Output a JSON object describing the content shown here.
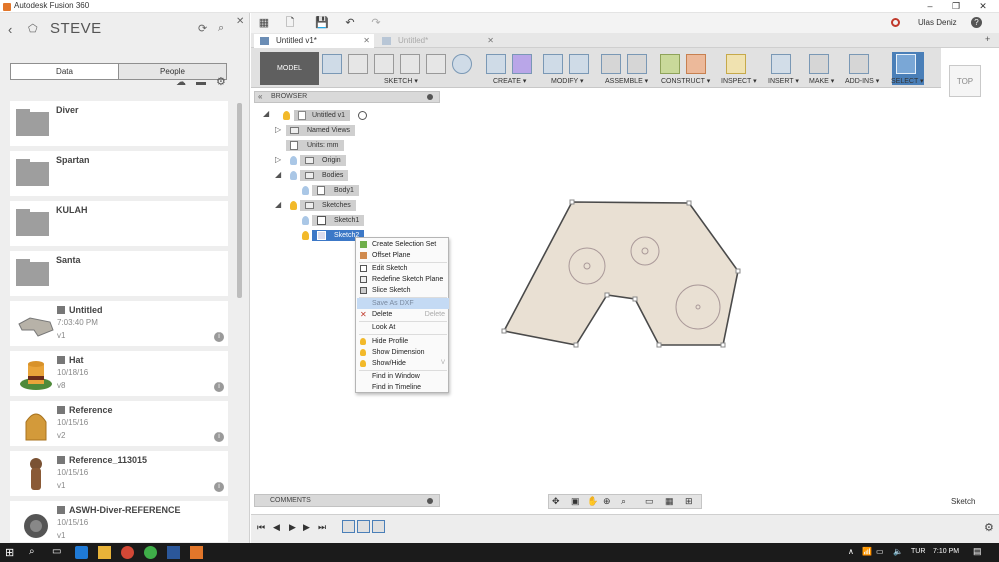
{
  "window": {
    "title": "Autodesk Fusion 360"
  },
  "data_panel": {
    "project": "STEVE",
    "tabs": [
      {
        "label": "Data"
      },
      {
        "label": "People"
      }
    ],
    "folders": [
      {
        "name": "Diver"
      },
      {
        "name": "Spartan"
      },
      {
        "name": "KULAH"
      },
      {
        "name": "Santa"
      }
    ],
    "designs": [
      {
        "name": "Untitled",
        "date": "7:03:40 PM",
        "version": "v1"
      },
      {
        "name": "Hat",
        "date": "10/18/16",
        "version": "v8"
      },
      {
        "name": "Reference",
        "date": "10/15/16",
        "version": "v2"
      },
      {
        "name": "Reference_113015",
        "date": "10/15/16",
        "version": "v1"
      },
      {
        "name": "ASWH-Diver-REFERENCE",
        "date": "10/15/16",
        "version": "v1"
      }
    ]
  },
  "user": {
    "name": "Ulas Deniz"
  },
  "doc_tabs": [
    {
      "label": "Untitled v1*"
    },
    {
      "label": "Untitled*"
    }
  ],
  "ribbon": {
    "workspace": "MODEL",
    "groups": [
      {
        "label": "SKETCH ▾"
      },
      {
        "label": "CREATE ▾"
      },
      {
        "label": "MODIFY ▾"
      },
      {
        "label": "ASSEMBLE ▾"
      },
      {
        "label": "CONSTRUCT ▾"
      },
      {
        "label": "INSPECT ▾"
      },
      {
        "label": "INSERT ▾"
      },
      {
        "label": "MAKE ▾"
      },
      {
        "label": "ADD-INS ▾"
      },
      {
        "label": "SELECT ▾"
      }
    ]
  },
  "viewcube": {
    "face": "TOP"
  },
  "browser": {
    "title": "BROWSER",
    "nodes": {
      "root": "Untitled v1",
      "named_views": "Named Views",
      "units": "Units: mm",
      "origin": "Origin",
      "bodies": "Bodies",
      "body1": "Body1",
      "sketches": "Sketches",
      "sketch1": "Sketch1",
      "sketch2": "Sketch2"
    }
  },
  "context_menu": {
    "items": [
      {
        "label": "Create Selection Set"
      },
      {
        "label": "Offset Plane"
      },
      {
        "label": "Edit Sketch"
      },
      {
        "label": "Redefine Sketch Plane"
      },
      {
        "label": "Slice Sketch"
      },
      {
        "label": "Save As DXF"
      },
      {
        "label": "Delete",
        "shortcut": "Delete"
      },
      {
        "label": "Look At"
      },
      {
        "label": "Hide Profile"
      },
      {
        "label": "Show Dimension"
      },
      {
        "label": "Show/Hide"
      },
      {
        "label": "Find in Window"
      },
      {
        "label": "Find in Timeline"
      }
    ],
    "highlighted": "Save As DXF"
  },
  "comments": {
    "title": "COMMENTS"
  },
  "status": {
    "mode": "Sketch"
  },
  "taskbar": {
    "lang": "TUR",
    "time": "7:10 PM"
  },
  "colors": {
    "accent": "#3c78c7",
    "sketch_fill": "#e9e0d3",
    "sketch_line": "#4a4a4a"
  }
}
